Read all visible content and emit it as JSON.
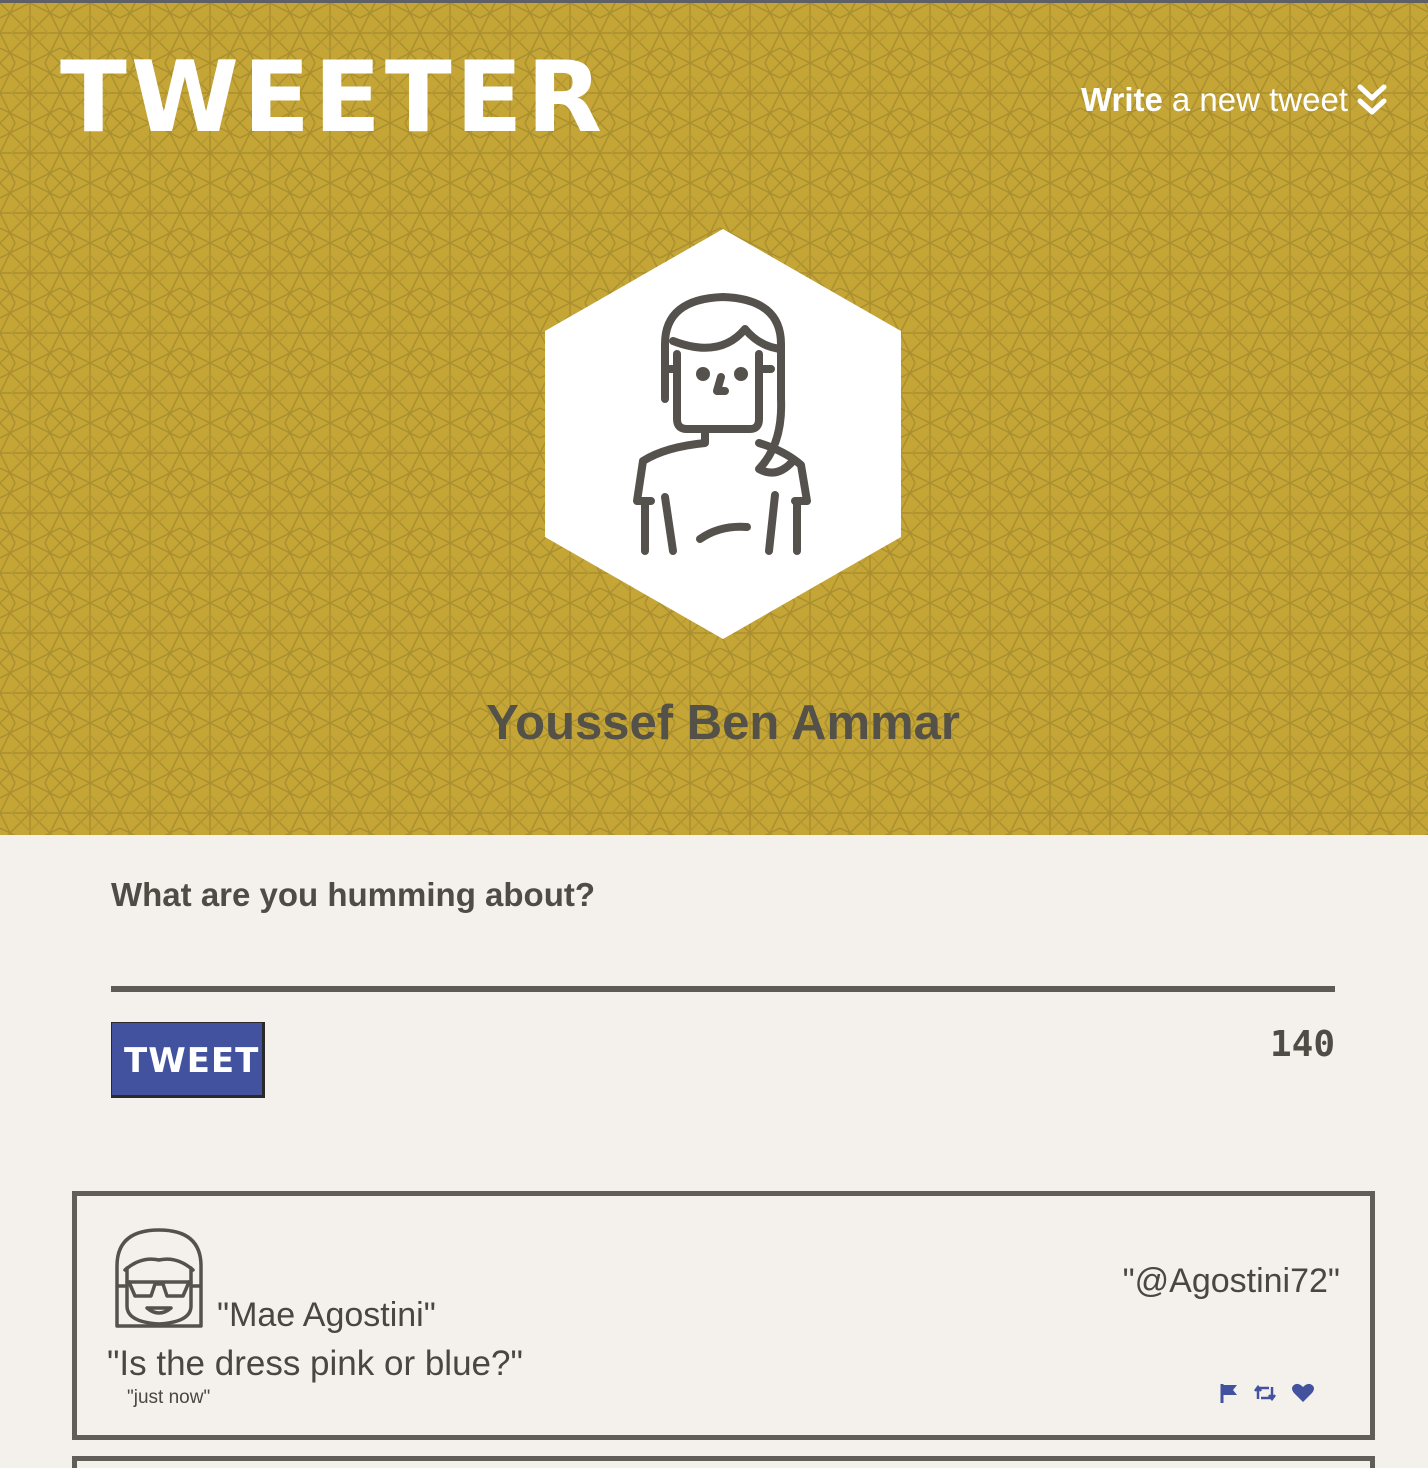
{
  "header": {
    "logo": "TWEETER",
    "write_bold": "Write",
    "write_rest": "a new tweet",
    "chevron_icon": "double-chevron-down-icon",
    "background_color": "#c4a536"
  },
  "profile": {
    "avatar_icon": "user-avatar-icon",
    "name": "Youssef Ben Ammar"
  },
  "compose": {
    "label": "What are you humming about?",
    "value": "",
    "button_label": "TWEET",
    "counter": "140",
    "button_color": "#43529f"
  },
  "tweets": [
    {
      "avatar_icon": "user-avatar-sunglasses-icon",
      "name": "\"Mae Agostini\"",
      "handle": "\"@Agostini72\"",
      "content": "\"Is the dress pink or blue?\"",
      "time": "\"just now\"",
      "actions": [
        "flag-icon",
        "retweet-icon",
        "heart-icon"
      ],
      "action_color": "#43529f"
    }
  ]
}
